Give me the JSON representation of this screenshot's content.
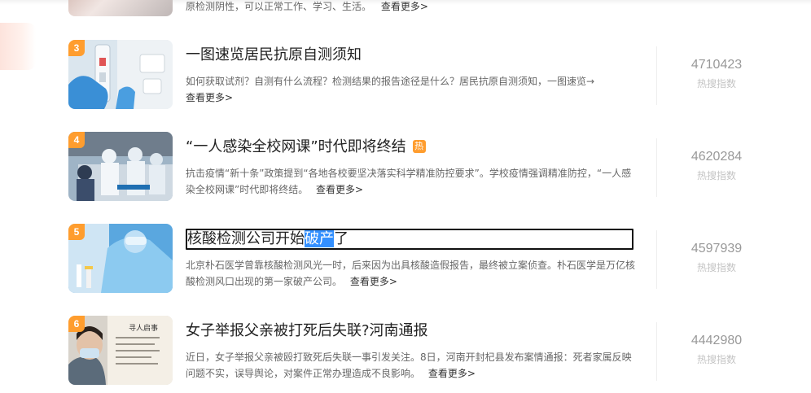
{
  "partial": {
    "desc": "原检测阴性，可以正常工作、学习、生活。",
    "more": "查看更多>"
  },
  "items": [
    {
      "rank": "3",
      "title": "一图速览居民抗原自测须知",
      "desc": "如何获取试剂？自测有什么流程？检测结果的报告途径是什么？居民抗原自测须知，一图速览→",
      "more": "查看更多>",
      "index": "4710423",
      "index_label": "热搜指数"
    },
    {
      "rank": "4",
      "title": "“一人感染全校网课”时代即将终结",
      "badge": "热",
      "desc": "抗击疫情“新十条”政策提到“各地各校要坚决落实科学精准防控要求”。学校疫情强调精准防控，“一人感染全校网课”时代即将终结。",
      "more": "查看更多>",
      "index": "4620284",
      "index_label": "热搜指数"
    },
    {
      "rank": "5",
      "title_pre": "核酸检测公司开始",
      "title_sel": "破产",
      "title_post": "了",
      "desc": "北京朴石医学曾靠核酸检测风光一时，后来因为出具核酸造假报告，最终被立案侦查。朴石医学是万亿核酸检测风口出现的第一家破产公司。",
      "more": "查看更多>",
      "index": "4597939",
      "index_label": "热搜指数"
    },
    {
      "rank": "6",
      "title": "女子举报父亲被打死后失联?河南通报",
      "desc": "近日，女子举报父亲被殴打致死后失联一事引发关注。8日，河南开封杞县发布案情通报：死者家属反映问题不实，误导舆论，对案件正常办理造成不良影响。",
      "more": "查看更多>",
      "index": "4442980",
      "index_label": "热搜指数",
      "thumb_text": "寻人启事"
    }
  ],
  "colors": {
    "rank_badge": "#ff9d2e",
    "selection": "#3390ff",
    "index_number": "#999999",
    "index_label": "#c4c4c4"
  }
}
